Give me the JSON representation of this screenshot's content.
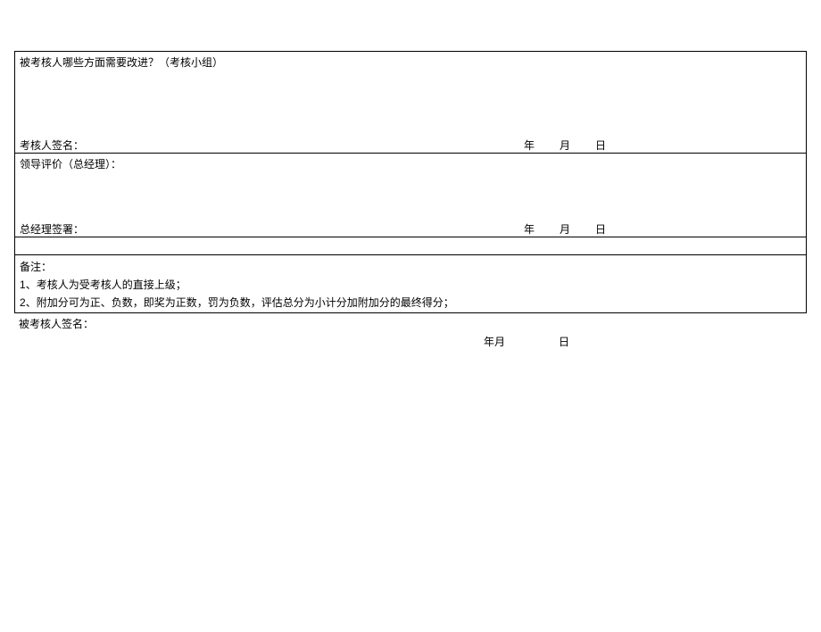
{
  "improvement": {
    "question": "被考核人哪些方面需要改进？（考核小组）",
    "sign_label": "考核人签名：",
    "date": {
      "year": "年",
      "month": "月",
      "day": "日"
    }
  },
  "leader": {
    "title": "领导评价（总经理）：",
    "sign_label": "总经理签署：",
    "date": {
      "year": "年",
      "month": "月",
      "day": "日"
    }
  },
  "notes": {
    "title": "备注：",
    "line1_prefix": "1",
    "line1_text": "、考核人为受考核人的直接上级；",
    "line2_prefix": "2",
    "line2_text": "、附加分可为正、负数，即奖为正数，罚为负数，评估总分为小计分加附加分的最终得分；"
  },
  "assessee": {
    "sign_label": "被考核人签名：",
    "date": {
      "ym": "年月",
      "day": "日"
    }
  }
}
